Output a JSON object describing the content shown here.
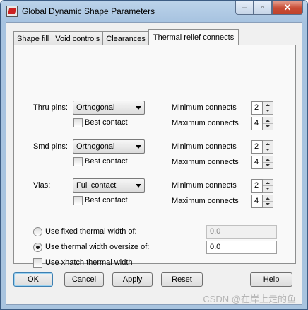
{
  "window": {
    "title": "Global Dynamic Shape Parameters",
    "close_symbol": "✕",
    "minimize_symbol": "–",
    "maximize_symbol": "▫"
  },
  "tabs": [
    {
      "label": "Shape fill",
      "active": false
    },
    {
      "label": "Void controls",
      "active": false
    },
    {
      "label": "Clearances",
      "active": false
    },
    {
      "label": "Thermal relief connects",
      "active": true
    }
  ],
  "rows": [
    {
      "label": "Thru pins:",
      "mode": "Orthogonal",
      "best_contact": "Best contact",
      "min_label": "Minimum connects",
      "min_value": "2",
      "max_label": "Maximum connects",
      "max_value": "4"
    },
    {
      "label": "Smd pins:",
      "mode": "Orthogonal",
      "best_contact": "Best contact",
      "min_label": "Minimum connects",
      "min_value": "2",
      "max_label": "Maximum connects",
      "max_value": "4"
    },
    {
      "label": "Vias:",
      "mode": "Full contact",
      "best_contact": "Best contact",
      "min_label": "Minimum connects",
      "min_value": "2",
      "max_label": "Maximum connects",
      "max_value": "4"
    }
  ],
  "width_options": {
    "fixed_label": "Use fixed thermal width of:",
    "fixed_value": "0.0",
    "oversize_label": "Use thermal width oversize of:",
    "oversize_value": "0.0",
    "xhatch_label": "Use xhatch thermal width"
  },
  "buttons": {
    "ok": "OK",
    "cancel": "Cancel",
    "apply": "Apply",
    "reset": "Reset",
    "help": "Help"
  },
  "watermark": "CSDN @在岸上走的鱼"
}
